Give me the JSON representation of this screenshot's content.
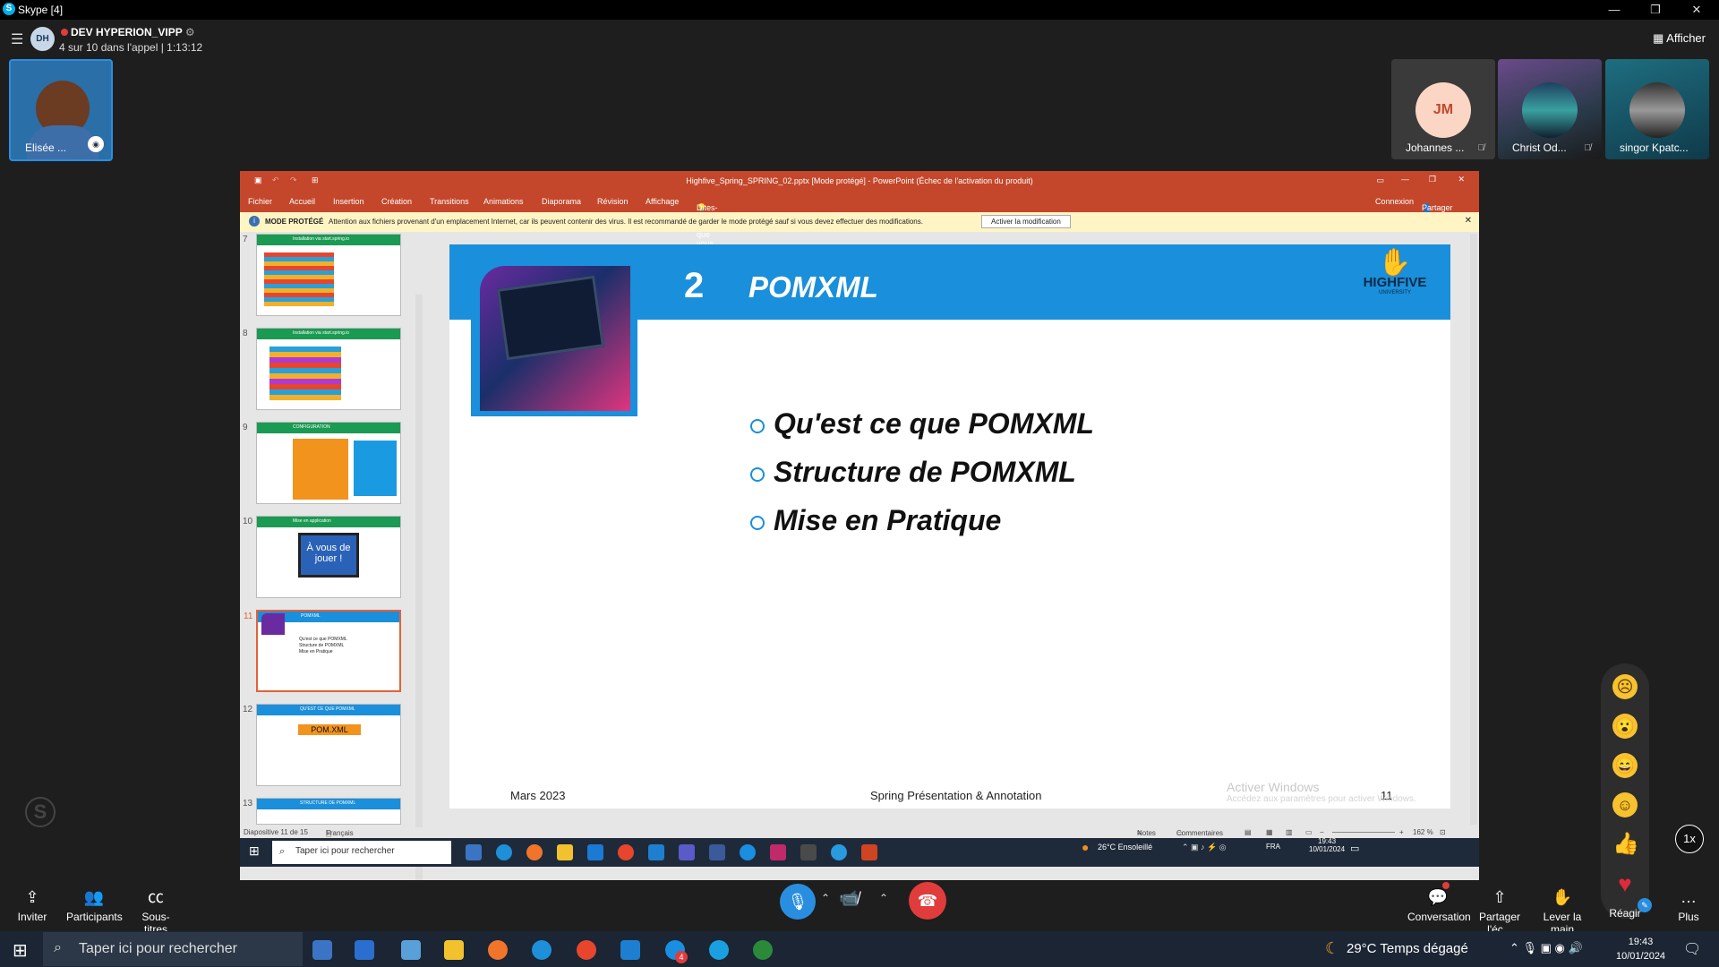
{
  "window": {
    "title": "Skype [4]",
    "controls": [
      "—",
      "❐",
      "✕"
    ]
  },
  "call": {
    "name": "DEV HYPERION_VIPP",
    "avatar_initials": "DH",
    "status": "4 sur 10 dans l'appel | 1:13:12",
    "show_label": "Afficher"
  },
  "participants": {
    "self_name": "Elisée ...",
    "tiles": [
      {
        "name": "Johannes ...",
        "initials": "JM"
      },
      {
        "name": "Christ Od..."
      },
      {
        "name": "singor Kpatc..."
      }
    ]
  },
  "ppt": {
    "title": "Highfive_Spring_SPRING_02.pptx [Mode protégé] - PowerPoint (Échec de l'activation du produit)",
    "tabs": [
      "Fichier",
      "Accueil",
      "Insertion",
      "Création",
      "Transitions",
      "Animations",
      "Diaporama",
      "Révision",
      "Affichage",
      "Dites-nous ce que vous voulez faire..."
    ],
    "signin": "Connexion",
    "share": "Partager",
    "protected_label": "MODE PROTÉGÉ",
    "protected_text": "Attention aux fichiers provenant d'un emplacement Internet, car ils peuvent contenir des virus. Il est recommandé de garder le mode protégé sauf si vous devez effectuer des modifications.",
    "protected_button": "Activer la modification",
    "thumbnails": [
      {
        "num": "7",
        "heading": "Installation via start.spring.io"
      },
      {
        "num": "8",
        "heading": "Installation via start.spring.io"
      },
      {
        "num": "9",
        "heading": "CONFIGURATION"
      },
      {
        "num": "10",
        "heading": "Mise en application",
        "body": "À vous de jouer !"
      },
      {
        "num": "11",
        "heading": "POMXML"
      },
      {
        "num": "12",
        "heading": "QU'EST CE QUE POMXML",
        "body": "POM.XML"
      },
      {
        "num": "13",
        "heading": "STRUCTURE DE POMXML"
      }
    ],
    "slide": {
      "number": "2",
      "title": "POMXML",
      "logo": "HIGHFIVE",
      "logo_sub": "UNIVERSITY",
      "bullets": [
        "Qu'est ce que POMXML",
        "Structure de POMXML",
        "Mise en Pratique"
      ],
      "footer_left": "Mars 2023",
      "footer_center": "Spring Présentation & Annotation",
      "footer_right": "11",
      "watermark_title": "Activer Windows",
      "watermark_sub": "Accédez aux paramètres pour activer Windows."
    },
    "status": {
      "slide_of": "Diapositive 11 de 15",
      "language": "Français (France)",
      "notes": "Notes",
      "comments": "Commentaires",
      "zoom": "162 %"
    }
  },
  "remote_taskbar": {
    "search": "Taper ici pour rechercher",
    "weather": "26°C  Ensoleillé",
    "lang": "FRA",
    "time": "19:43",
    "date": "10/01/2024"
  },
  "controls": {
    "invite": "Inviter",
    "participants": "Participants",
    "subtitles": "Sous-titres",
    "conversation": "Conversation",
    "share": "Partager l'éc...",
    "raise_hand": "Lever la main",
    "react": "Réagir",
    "more": "Plus",
    "speed": "1x"
  },
  "taskbar": {
    "search": "Taper ici pour rechercher",
    "weather": "29°C  Temps dégagé",
    "time": "19:43",
    "date": "10/01/2024",
    "skype_badge": "4"
  }
}
